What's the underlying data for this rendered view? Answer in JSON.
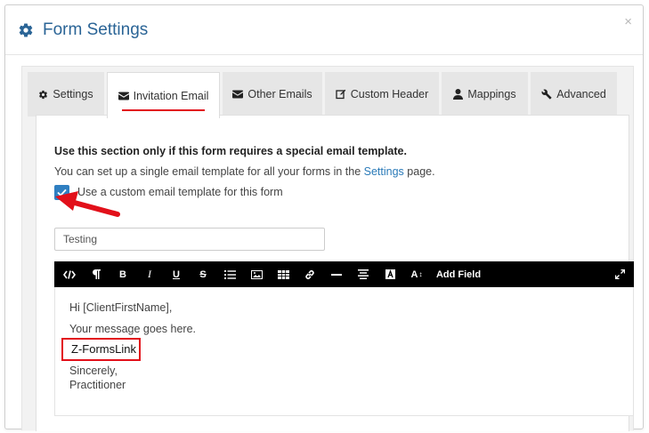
{
  "dialog": {
    "title": "Form Settings",
    "close_label": "×"
  },
  "tabs": [
    {
      "label": "Settings",
      "icon": "gear-icon"
    },
    {
      "label": "Invitation Email",
      "icon": "envelope-icon",
      "active": true
    },
    {
      "label": "Other Emails",
      "icon": "envelope-icon"
    },
    {
      "label": "Custom Header",
      "icon": "edit-icon"
    },
    {
      "label": "Mappings",
      "icon": "user-icon"
    },
    {
      "label": "Advanced",
      "icon": "wrench-icon"
    }
  ],
  "panel": {
    "heading": "Use this section only if this form requires a special email template.",
    "desc_before": "You can set up a single email template for all your forms in the ",
    "desc_link": "Settings",
    "desc_after": " page.",
    "checkbox_label": "Use a custom email template for this form",
    "checkbox_checked": true,
    "subject_value": "Testing"
  },
  "toolbar": {
    "add_field_label": "Add Field",
    "buttons": [
      "code-view-icon",
      "paragraph-icon",
      "bold-icon",
      "italic-icon",
      "underline-icon",
      "strikethrough-icon",
      "list-icon",
      "image-icon",
      "table-icon",
      "link-icon",
      "horizontal-rule-icon",
      "align-icon",
      "font-color-icon",
      "font-size-icon",
      "fullscreen-icon"
    ]
  },
  "editor": {
    "greeting": "Hi [ClientFirstName],",
    "message": "Your message goes here.",
    "link_token": "Z-FormsLink",
    "closing": "Sincerely,",
    "signature": "Practitioner"
  },
  "colors": {
    "title_blue": "#2a6496",
    "annotation_red": "#e2101a",
    "checkbox_blue": "#2f7fc1",
    "toolbar_bg": "#000000"
  }
}
